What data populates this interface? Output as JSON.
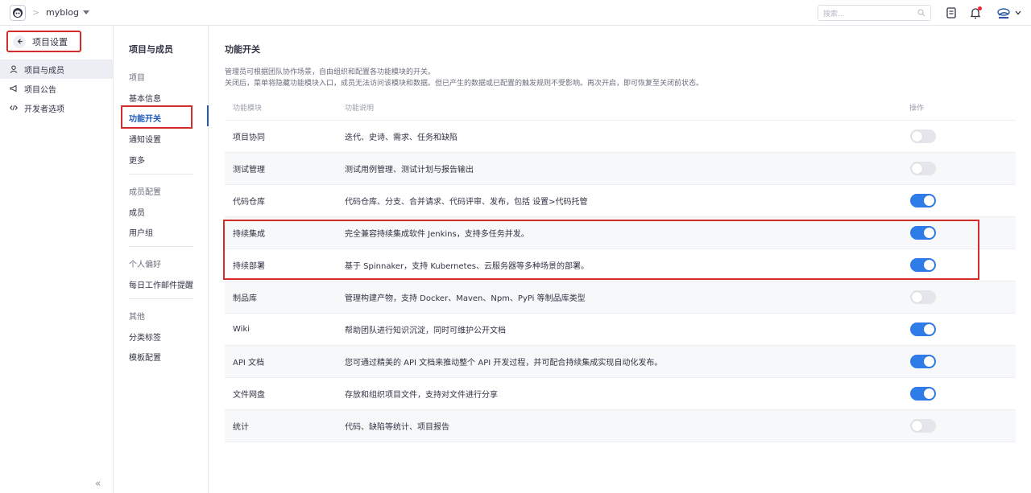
{
  "topbar": {
    "project_name": "myblog",
    "separator": ">",
    "search_placeholder": "搜索..."
  },
  "sidebar": {
    "back_label": "项目设置",
    "items": [
      {
        "label": "项目与成员",
        "icon": "user-icon",
        "active": true
      },
      {
        "label": "项目公告",
        "icon": "megaphone-icon",
        "active": false
      },
      {
        "label": "开发者选项",
        "icon": "code-icon",
        "active": false
      }
    ],
    "collapse_label": "«"
  },
  "subnav": {
    "title": "项目与成员",
    "groups": [
      {
        "label": "项目",
        "items": [
          "基本信息",
          "功能开关",
          "通知设置",
          "更多"
        ]
      },
      {
        "label": "成员配置",
        "items": [
          "成员",
          "用户组"
        ]
      },
      {
        "label": "个人偏好",
        "items": [
          "每日工作邮件提醒"
        ]
      },
      {
        "label": "其他",
        "items": [
          "分类标签",
          "模板配置"
        ]
      }
    ],
    "active_item": "功能开关"
  },
  "main": {
    "title": "功能开关",
    "desc_line1": "管理员可根据团队协作场景，自由组织和配置各功能模块的开关。",
    "desc_line2": "关闭后，菜单将隐藏功能模块入口，成员无法访问该模块和数据。但已产生的数据或已配置的触发规则不受影响。再次开启，即可恢复至关闭前状态。",
    "table": {
      "headers": {
        "name": "功能模块",
        "desc": "功能说明",
        "op": "操作"
      },
      "rows": [
        {
          "name": "项目协同",
          "desc": "迭代、史诗、需求、任务和缺陷",
          "enabled": false
        },
        {
          "name": "测试管理",
          "desc": "测试用例管理、测试计划与报告输出",
          "enabled": false
        },
        {
          "name": "代码仓库",
          "desc": "代码仓库、分支、合并请求、代码评审、发布，包括 设置>代码托管",
          "enabled": true
        },
        {
          "name": "持续集成",
          "desc": "完全兼容持续集成软件 Jenkins，支持多任务并发。",
          "enabled": true
        },
        {
          "name": "持续部署",
          "desc": "基于 Spinnaker，支持 Kubernetes、云服务器等多种场景的部署。",
          "enabled": true
        },
        {
          "name": "制品库",
          "desc": "管理构建产物，支持 Docker、Maven、Npm、PyPi 等制品库类型",
          "enabled": false
        },
        {
          "name": "Wiki",
          "desc": "帮助团队进行知识沉淀，同时可维护公开文档",
          "enabled": true
        },
        {
          "name": "API 文档",
          "desc": "您可通过精美的 API 文档来推动整个 API 开发过程，并可配合持续集成实现自动化发布。",
          "enabled": true
        },
        {
          "name": "文件网盘",
          "desc": "存放和组织项目文件，支持对文件进行分享",
          "enabled": true
        },
        {
          "name": "统计",
          "desc": "代码、缺陷等统计、项目报告",
          "enabled": false
        }
      ]
    }
  },
  "colors": {
    "accent": "#2f7be8",
    "highlight": "#d42b2b",
    "toggle_off": "#e4e6eb"
  }
}
